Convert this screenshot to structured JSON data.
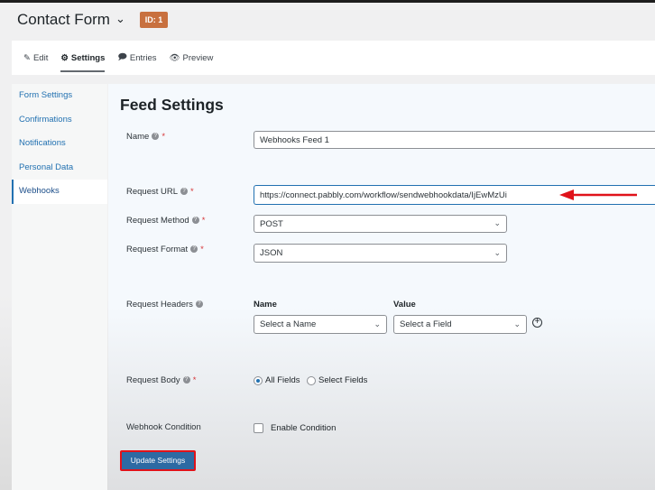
{
  "header": {
    "title": "Contact Form",
    "id_badge": "ID: 1"
  },
  "tabs": [
    {
      "label": "Edit",
      "icon": "edit-icon"
    },
    {
      "label": "Settings",
      "icon": "gears-icon",
      "active": true
    },
    {
      "label": "Entries",
      "icon": "comment-icon"
    },
    {
      "label": "Preview",
      "icon": "eye-icon"
    }
  ],
  "sidebar": {
    "items": [
      {
        "label": "Form Settings"
      },
      {
        "label": "Confirmations"
      },
      {
        "label": "Notifications"
      },
      {
        "label": "Personal Data"
      },
      {
        "label": "Webhooks",
        "active": true
      }
    ]
  },
  "main": {
    "heading": "Feed Settings",
    "name": {
      "label": "Name",
      "value": "Webhooks Feed 1"
    },
    "request_url": {
      "label": "Request URL",
      "value": "https://connect.pabbly.com/workflow/sendwebhookdata/IjEwMzUi"
    },
    "request_method": {
      "label": "Request Method",
      "value": "POST"
    },
    "request_format": {
      "label": "Request Format",
      "value": "JSON"
    },
    "request_headers": {
      "label": "Request Headers",
      "name_col": "Name",
      "value_col": "Value",
      "name_select": "Select a Name",
      "value_select": "Select a Field"
    },
    "request_body": {
      "label": "Request Body",
      "options": [
        "All Fields",
        "Select Fields"
      ],
      "selected": "All Fields"
    },
    "webhook_condition": {
      "label": "Webhook Condition",
      "checkbox": "Enable Condition",
      "checked": false
    },
    "update_button": "Update Settings"
  },
  "colors": {
    "accent": "#2271b1",
    "badge": "#c8703f",
    "annotation": "#e0121a"
  }
}
